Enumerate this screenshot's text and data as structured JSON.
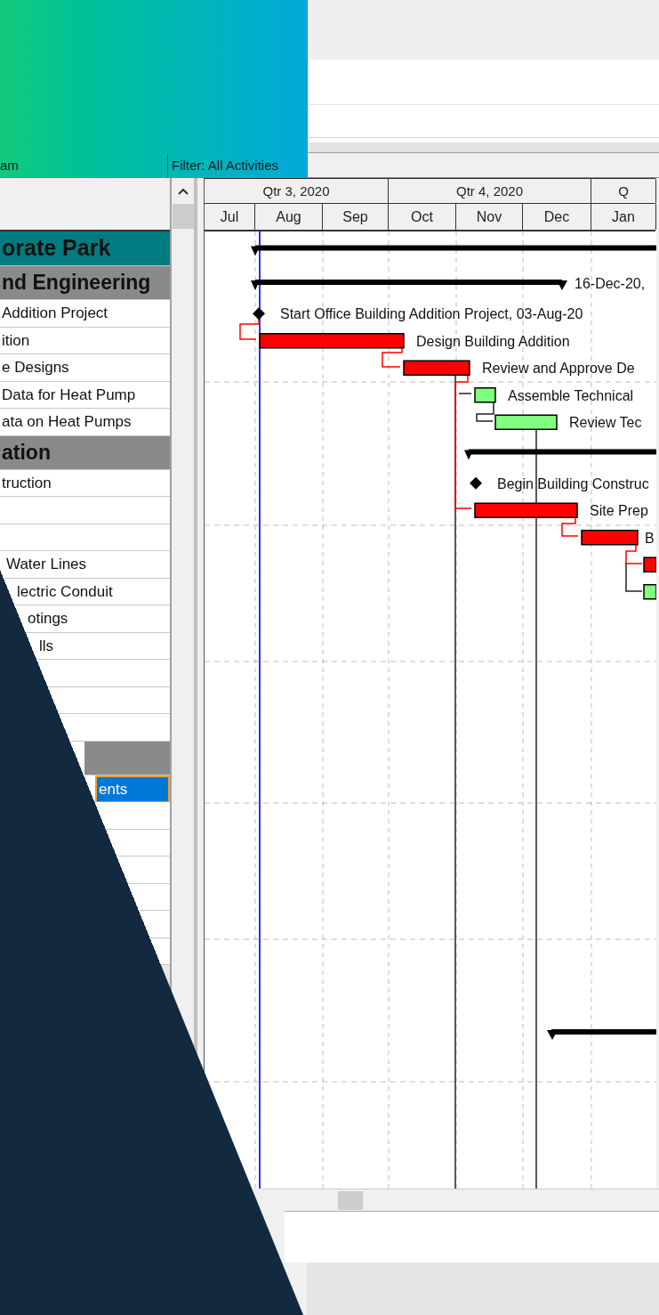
{
  "toolbar": {
    "layout_label": "am",
    "filter": "Filter: All Activities"
  },
  "timescale": {
    "quarters": [
      "Qtr 3, 2020",
      "Qtr 4, 2020",
      "Q"
    ],
    "months": [
      "Jul",
      "Aug",
      "Sep",
      "Oct",
      "Nov",
      "Dec",
      "Jan"
    ]
  },
  "rows": [
    {
      "kind": "project",
      "name": "orate Park",
      "bar": {
        "kind": "summary"
      },
      "selected": false
    },
    {
      "kind": "wbs",
      "name": "nd Engineering",
      "bar": {
        "kind": "summary",
        "label": "16-Dec-20,"
      },
      "selected": false
    },
    {
      "kind": "activity",
      "name": "Addition Project",
      "bar": {
        "kind": "milestone",
        "label": "Start Office Building Addition Project, 03-Aug-20"
      },
      "selected": false
    },
    {
      "kind": "activity",
      "name": "ition",
      "bar": {
        "kind": "critical",
        "label": "Design Building Addition"
      },
      "selected": false
    },
    {
      "kind": "activity",
      "name": "e Designs",
      "bar": {
        "kind": "critical",
        "label": "Review and Approve De"
      },
      "selected": false
    },
    {
      "kind": "activity",
      "name": "Data for Heat Pump",
      "bar": {
        "kind": "normal",
        "label": "Assemble Technical"
      },
      "selected": false
    },
    {
      "kind": "activity",
      "name": "ata on Heat Pumps",
      "bar": {
        "kind": "normal",
        "label": "Review Tec"
      },
      "selected": false
    },
    {
      "kind": "wbs",
      "name": "ation",
      "bar": {
        "kind": "summary"
      },
      "selected": false
    },
    {
      "kind": "activity",
      "name": "truction",
      "bar": {
        "kind": "milestone",
        "label": "Begin Building Construc"
      },
      "selected": false
    },
    {
      "kind": "activity",
      "bar": {
        "kind": "critical",
        "label": "Site Prep"
      },
      "selected": false
    },
    {
      "kind": "activity",
      "bar": {
        "kind": "critical",
        "label": "B"
      },
      "selected": false
    },
    {
      "kind": "activity",
      "name": "Water Lines",
      "bar": {
        "kind": "critical"
      },
      "selected": false
    },
    {
      "kind": "activity",
      "name": "lectric Conduit",
      "bar": {
        "kind": "normal"
      },
      "selected": false
    },
    {
      "kind": "activity",
      "name": "otings",
      "selected": false
    },
    {
      "kind": "activity",
      "name": "lls",
      "selected": false
    },
    {
      "kind": "activity",
      "selected": false
    },
    {
      "kind": "activity",
      "selected": false
    },
    {
      "kind": "activity",
      "selected": false
    },
    {
      "kind": "wbs",
      "selected": false
    },
    {
      "kind": "activity",
      "name": "ents",
      "selected": true
    },
    {
      "kind": "activity",
      "selected": false
    },
    {
      "kind": "activity",
      "selected": false
    },
    {
      "kind": "activity",
      "selected": false
    },
    {
      "kind": "activity",
      "selected": false
    },
    {
      "kind": "activity",
      "selected": false
    },
    {
      "kind": "activity",
      "selected": false
    }
  ]
}
